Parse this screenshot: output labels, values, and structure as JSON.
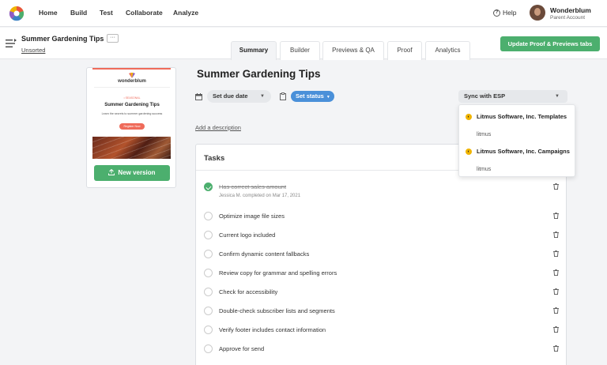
{
  "nav": {
    "items": [
      "Home",
      "Build",
      "Test",
      "Collaborate",
      "Analyze"
    ],
    "help": "Help",
    "account_name": "Wonderblum",
    "account_sub": "Parent Account"
  },
  "subheader": {
    "title": "Summer Gardening Tips",
    "more": "···",
    "folder": "Unsorted",
    "tabs": [
      "Summary",
      "Builder",
      "Previews & QA",
      "Proof",
      "Analytics"
    ],
    "active_tab": "Summary",
    "update_button": "Update Proof & Previews tabs"
  },
  "preview": {
    "brand": "wonderblum",
    "tag": "• SEASONAL",
    "title": "Summer Gardening Tips",
    "subtitle": "Learn the secrets to summer gardening success",
    "cta": "Register Now",
    "new_version": "New version"
  },
  "main": {
    "title": "Summer Gardening Tips",
    "due_date": "Set due date",
    "status": "Set status",
    "add_description": "Add a description",
    "esp": {
      "button": "Sync with ESP",
      "options": [
        {
          "name": "Litmus Software, Inc. Templates",
          "sub": "litmus"
        },
        {
          "name": "Litmus Software, Inc. Campaigns",
          "sub": "litmus"
        }
      ]
    }
  },
  "tasks": {
    "heading": "Tasks",
    "items": [
      {
        "label": "Has correct sales amount",
        "done": true,
        "meta": "Jessica M. completed on Mar 17, 2021"
      },
      {
        "label": "Optimize image file sizes",
        "done": false
      },
      {
        "label": "Current logo included",
        "done": false
      },
      {
        "label": "Confirm dynamic content fallbacks",
        "done": false
      },
      {
        "label": "Review copy for grammar and spelling errors",
        "done": false
      },
      {
        "label": "Check for accessibility",
        "done": false
      },
      {
        "label": "Double-check subscriber lists and segments",
        "done": false
      },
      {
        "label": "Verify footer includes contact information",
        "done": false
      },
      {
        "label": "Approve for send",
        "done": false
      }
    ]
  },
  "colors": {
    "accent_green": "#4caf6e",
    "status_blue": "#4a90d9",
    "brand_coral": "#ef6b5a"
  }
}
